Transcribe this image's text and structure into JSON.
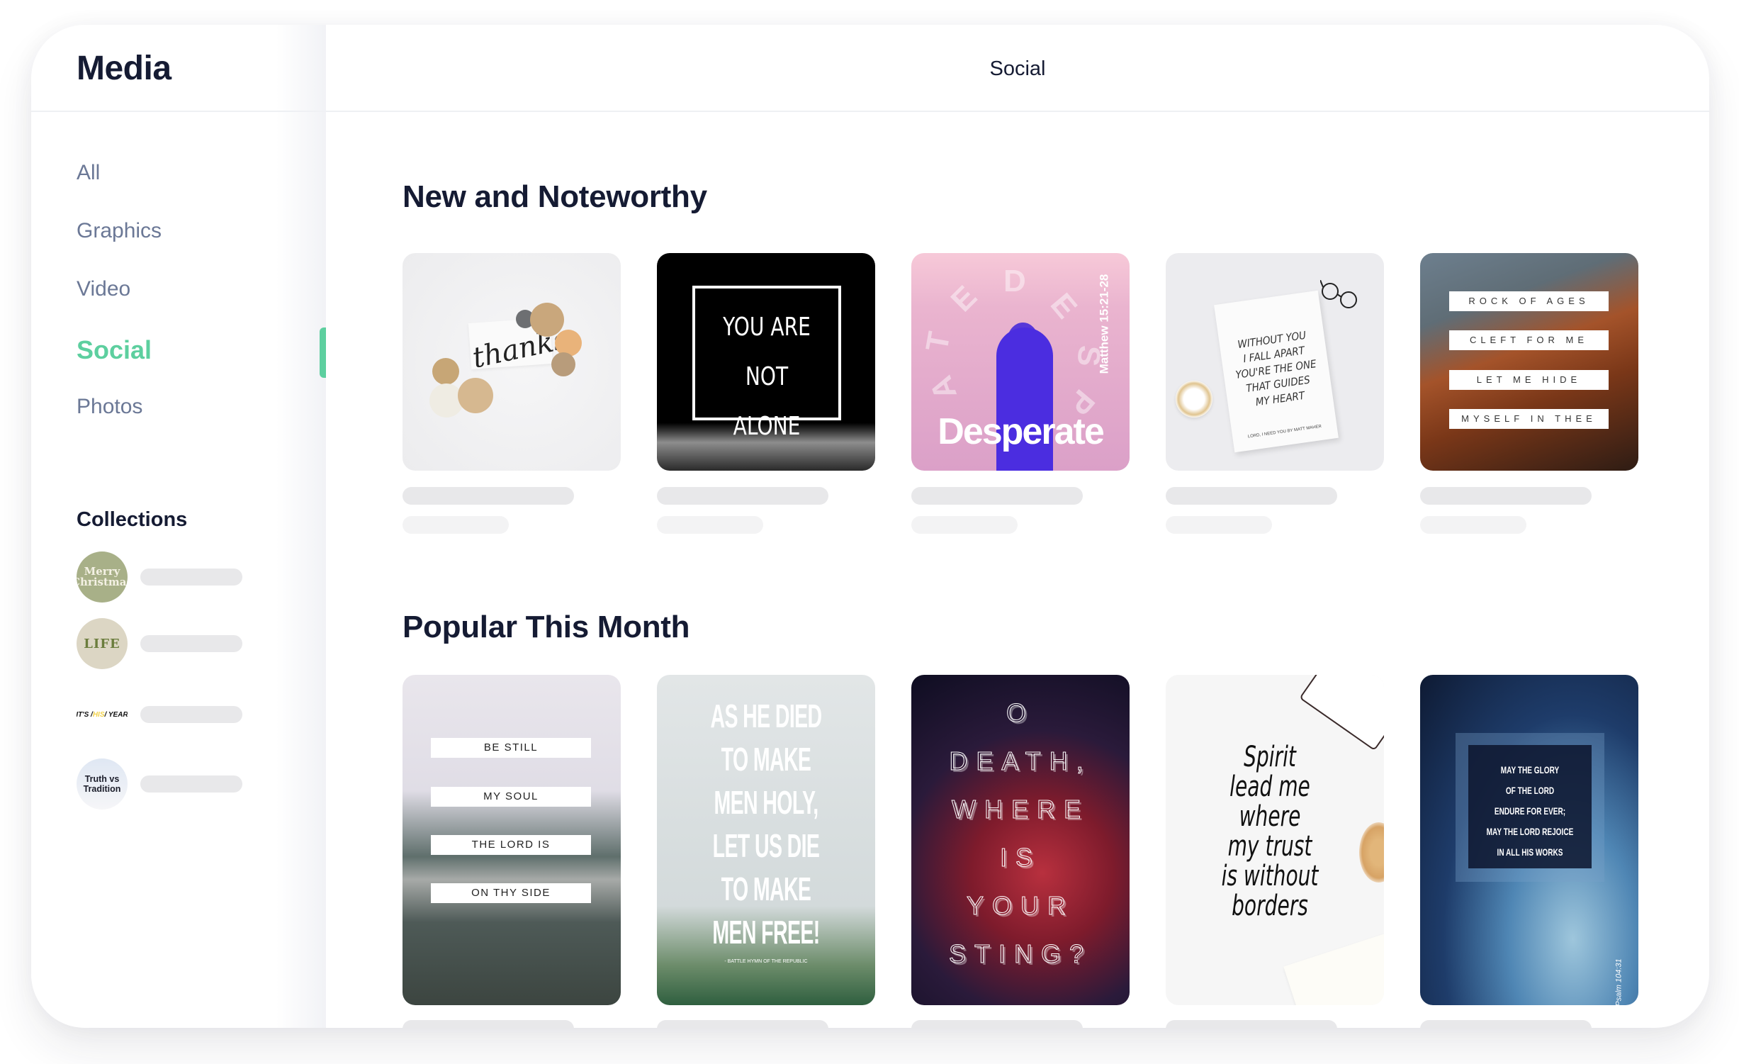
{
  "sidebar": {
    "title": "Media",
    "nav": [
      {
        "label": "All",
        "active": false
      },
      {
        "label": "Graphics",
        "active": false
      },
      {
        "label": "Video",
        "active": false
      },
      {
        "label": "Social",
        "active": true
      },
      {
        "label": "Photos",
        "active": false
      }
    ],
    "collections_title": "Collections",
    "collections": [
      {
        "thumbnail_text": "Merry Christmas"
      },
      {
        "thumbnail_text": "LIFE"
      },
      {
        "thumbnail_text_parts": [
          "IT'S / ",
          "HIS",
          " / YEAR"
        ]
      },
      {
        "thumbnail_text": "Truth vs Tradition"
      }
    ]
  },
  "header": {
    "title": "Social"
  },
  "sections": [
    {
      "title": "New and Noteworthy",
      "cards": [
        {
          "text": "thanks"
        },
        {
          "text": "YOU ARE NOT ALONE"
        },
        {
          "text": "Desperate",
          "reference": "Matthew 15:21-28",
          "letters": [
            "D",
            "E",
            "S",
            "P",
            "A",
            "T",
            "E"
          ]
        },
        {
          "text": "WITHOUT YOU I FALL APART YOU'RE THE ONE THAT GUIDES MY HEART",
          "lines": [
            "WITHOUT YOU",
            "I FALL APART",
            "YOU'RE THE ONE",
            "THAT GUIDES",
            "MY HEART"
          ],
          "credit": "LORD, I NEED YOU BY MATT MAHER"
        },
        {
          "text": "ROCK OF AGES CLEFT FOR ME LET ME HIDE MYSELF IN THEE",
          "lines": [
            "ROCK OF AGES",
            "CLEFT FOR ME",
            "LET ME HIDE",
            "MYSELF IN THEE"
          ]
        }
      ]
    },
    {
      "title": "Popular This Month",
      "cards": [
        {
          "lines": [
            "BE STILL",
            "MY SOUL",
            "THE LORD IS",
            "ON THY SIDE"
          ]
        },
        {
          "lines": [
            "AS HE DIED",
            "TO MAKE",
            "MEN HOLY,",
            "LET US DIE",
            "TO MAKE",
            "MEN FREE!"
          ],
          "credit": "- BATTLE HYMN OF THE REPUBLIC"
        },
        {
          "lines": [
            "O",
            "DEATH,",
            "WHERE",
            "IS",
            "YOUR",
            "STING?"
          ]
        },
        {
          "lines": [
            "Spirit",
            "lead me",
            "where",
            "my trust",
            "is without",
            "borders"
          ]
        },
        {
          "lines": [
            "MAY THE GLORY",
            "OF THE LORD",
            "ENDURE FOR EVER;",
            "MAY THE LORD REJOICE",
            "IN ALL HIS WORKS"
          ],
          "reference": "Psalm 104:31"
        }
      ]
    }
  ],
  "colors": {
    "accent": "#5dcf9f",
    "heading": "#151b33",
    "nav_text": "#6b7896",
    "skeleton": "#e8e8ea"
  }
}
